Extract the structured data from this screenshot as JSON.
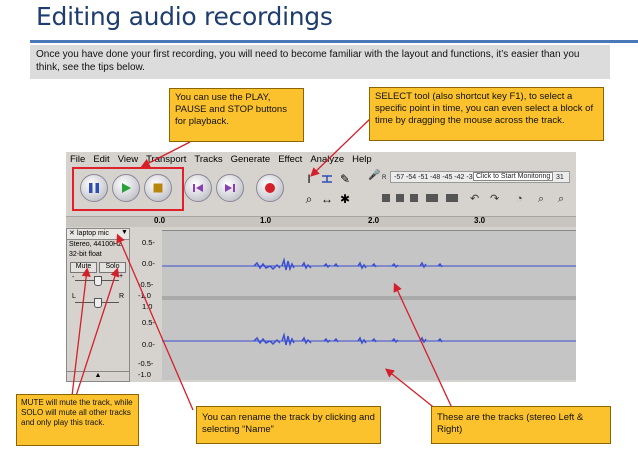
{
  "slide": {
    "title": "Editing audio recordings",
    "intro": "Once you have done your first recording, you will need to become familiar with the layout and functions, it’s easier than you think, see the tips below."
  },
  "app": {
    "menu": [
      "File",
      "Edit",
      "View",
      "Transport",
      "Tracks",
      "Generate",
      "Effect",
      "Analyze",
      "Help"
    ],
    "transport_buttons": [
      {
        "name": "pause",
        "icon": "pause-icon",
        "color": "#2f4fb0"
      },
      {
        "name": "play",
        "icon": "play-icon",
        "color": "#27a33a"
      },
      {
        "name": "stop",
        "icon": "stop-icon",
        "color": "#b8860b"
      },
      {
        "name": "skip-start",
        "icon": "skip-start-icon",
        "color": "#8a3fb0"
      },
      {
        "name": "skip-end",
        "icon": "skip-end-icon",
        "color": "#8a3fb0"
      },
      {
        "name": "record",
        "icon": "record-icon",
        "color": "#d3202a"
      }
    ],
    "meter_scale": "-57 -54 -51 -48 -45 -42 -3",
    "meter_button": "Click to Start Monitoring",
    "meter_tail": "31",
    "meter_channel": "R",
    "ruler_ticks": [
      "0.0",
      "1.0",
      "2.0",
      "3.0"
    ],
    "track": {
      "name": "laptop mic",
      "format": "Stereo, 44100Hz",
      "bit": "32-bit float",
      "mute_label": "Mute",
      "solo_label": "Solo",
      "gain_minus": "-",
      "gain_plus": "+",
      "pan_left": "L",
      "pan_right": "R"
    },
    "scale_top": [
      "0.5-",
      "0.0-",
      "-0.5-",
      "-1.0"
    ],
    "scale_bottom": [
      "1.0",
      "0.5-",
      "0.0-",
      "-0.5-",
      "-1.0"
    ]
  },
  "notes": {
    "play": "You can use the PLAY, PAUSE and STOP buttons for playback.",
    "select": "SELECT tool (also shortcut key F1), to select a specific point in time, you can even select a block of time by dragging the mouse across the track.",
    "mute": "MUTE will mute the track, while SOLO will mute all other tracks and only play this track.",
    "rename": "You can rename the track by clicking and selecting “Name”",
    "tracks": "These are the tracks (stereo  Left & Right)"
  },
  "colors": {
    "accent": "#4a78b8",
    "note": "#fbc22e",
    "arrow": "#d3202a",
    "highlight": "#e0202a",
    "wave": "#3b4fd0"
  }
}
